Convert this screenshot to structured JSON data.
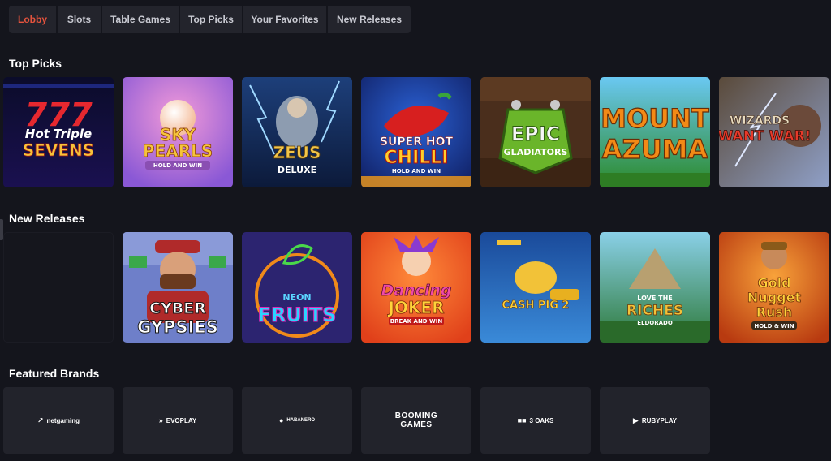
{
  "tabs": [
    {
      "label": "Lobby",
      "active": true
    },
    {
      "label": "Slots"
    },
    {
      "label": "Table Games"
    },
    {
      "label": "Top Picks"
    },
    {
      "label": "Your Favorites"
    },
    {
      "label": "New Releases"
    }
  ],
  "sections": {
    "top_picks": "Top Picks",
    "new_releases": "New Releases",
    "featured_brands": "Featured Brands"
  },
  "top_picks": [
    {
      "line1": "Hot Triple",
      "line2": "SEVENS",
      "accent": "#e6282f"
    },
    {
      "line1": "SKY",
      "line2": "PEARLS",
      "line3": "HOLD AND WIN",
      "accent": "#b970e6"
    },
    {
      "line1": "ZEUS",
      "line2": "DELUXE",
      "accent": "#3c7fd1"
    },
    {
      "line1": "SUPER HOT",
      "line2": "CHILLI",
      "line3": "HOLD AND WIN",
      "accent": "#d31f1f"
    },
    {
      "line1": "EPIC",
      "line2": "GLADIATORS",
      "accent": "#5a3a26"
    },
    {
      "line1": "MOUNT",
      "line2": "AZUMA",
      "accent": "#2f9a45"
    },
    {
      "line1": "WIZARDS",
      "line2": "WANT WAR!",
      "accent": "#7b6f7f"
    }
  ],
  "new_releases": [
    {
      "line1": "CYBER",
      "line2": "GYPSIES",
      "accent": "#6a7cc8"
    },
    {
      "line1": "NEON",
      "line2": "FRUITS",
      "accent": "#3a2f85"
    },
    {
      "line1": "Dancing",
      "line2": "JOKER",
      "line3": "BREAK AND WIN",
      "accent": "#ef5a2a"
    },
    {
      "line1": "CASH PIG 2",
      "accent": "#1e63b8"
    },
    {
      "line1": "LOVE THE",
      "line2": "RICHES",
      "line3": "ELDORADO",
      "accent": "#3d8a4a"
    },
    {
      "line1": "Gold",
      "line2": "Nugget",
      "line3": "Rush",
      "line4": "HOLD & WIN",
      "accent": "#d2541d"
    }
  ],
  "brands": [
    {
      "name": "netgaming",
      "icon": "n-icon"
    },
    {
      "name": "EVOPLAY",
      "icon": "chevron-icon"
    },
    {
      "name": "HABANERO",
      "icon": "pepper-icon"
    },
    {
      "name": "BOOMING",
      "name2": "GAMES"
    },
    {
      "name": "3 OAKS",
      "icon": "oaks-icon"
    },
    {
      "name": "RUBYPLAY",
      "icon": "play-icon"
    }
  ]
}
